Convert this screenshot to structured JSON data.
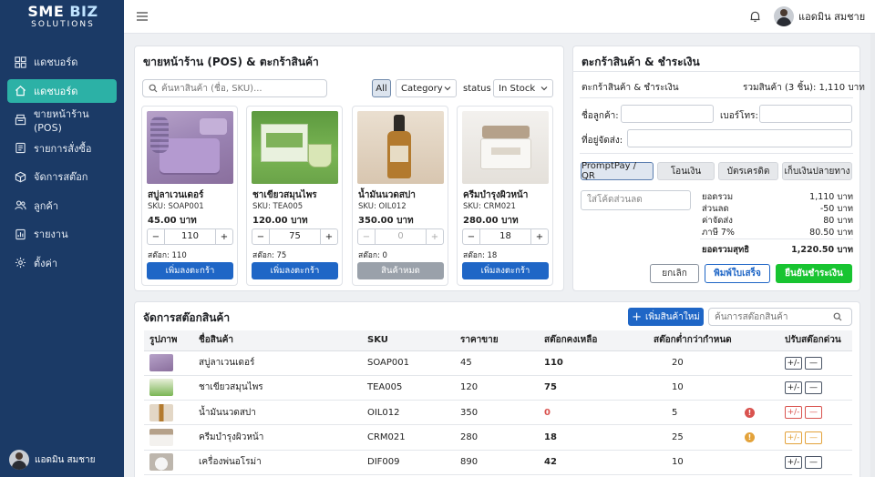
{
  "app": {
    "logo_line1": "SME",
    "logo_line1b": " BIZ",
    "logo_line2": "SOLUTIONS"
  },
  "sidebar": {
    "items": [
      {
        "label": "แดชบอร์ด",
        "icon": "grid-icon"
      },
      {
        "label": "แดชบอร์ด",
        "icon": "home-icon",
        "active": true
      },
      {
        "label": "ขายหน้าร้าน (POS)",
        "icon": "register-icon"
      },
      {
        "label": "รายการสั่งซื้อ",
        "icon": "list-icon"
      },
      {
        "label": "จัดการสต๊อก",
        "icon": "box-icon"
      },
      {
        "label": "ลูกค้า",
        "icon": "users-icon"
      },
      {
        "label": "รายงาน",
        "icon": "chart-icon"
      },
      {
        "label": "ตั้งค่า",
        "icon": "gear-icon"
      }
    ],
    "user_name": "แอดมิน สมชาย"
  },
  "topbar": {
    "user_name": "แอดมิน สมชาย"
  },
  "pos": {
    "title": "ขายหน้าร้าน (POS) & ตะกร้าสินค้า",
    "search_placeholder": "ค้นหาสินค้า (ชื่อ, SKU)...",
    "filter_all": "All",
    "category_label": "Category",
    "status_label": "status",
    "status_value": "In Stock",
    "products": [
      {
        "name": "สบู่ลาเวนเดอร์",
        "sku": "SKU: SOAP001",
        "price": "45.00 บาท",
        "qty": "110",
        "stock": "สต๊อก: 110",
        "button": "เพิ่มลงตะกร้า",
        "disabled": false
      },
      {
        "name": "ชาเขียวสมุนไพร",
        "sku": "SKU: TEA005",
        "price": "120.00 บาท",
        "qty": "75",
        "stock": "สต๊อก: 75",
        "button": "เพิ่มลงตะกร้า",
        "disabled": false
      },
      {
        "name": "น้ำมันนวดสปา",
        "sku": "SKU: OIL012",
        "price": "350.00 บาท",
        "qty": "0",
        "stock": "สต๊อก: 0",
        "button": "สินค้าหมด",
        "disabled": true
      },
      {
        "name": "ครีมบำรุงผิวหน้า",
        "sku": "SKU: CRM021",
        "price": "280.00 บาท",
        "qty": "18",
        "stock": "สต๊อก: 18",
        "button": "เพิ่มลงตะกร้า",
        "disabled": false
      }
    ]
  },
  "cart": {
    "title": "ตะกร้าสินค้า & ชำระเงิน",
    "subtitle": "ตะกร้าสินค้า & ชำระเงิน",
    "total_items": "รวมสินค้า (3 ชิ้น): 1,110 บาท",
    "customer_label": "ชื่อลูกค้า:",
    "phone_label": "เบอร์โทร:",
    "address_label": "ที่อยู่จัดส่ง:",
    "pay_methods": [
      "PromptPay / QR",
      "โอนเงิน",
      "บัตรเครดิต",
      "เก็บเงินปลายทาง"
    ],
    "discount_placeholder": "ใส่โค้ดส่วนลด",
    "summary": [
      {
        "label": "ยอดรวม",
        "value": "1,110 บาท"
      },
      {
        "label": "ส่วนลด",
        "value": "-50 บาท"
      },
      {
        "label": "ค่าจัดส่ง",
        "value": "80 บาท"
      },
      {
        "label": "ภาษี 7%",
        "value": "80.50 บาท"
      }
    ],
    "grand_label": "ยอดรวมสุทธิ",
    "grand_value": "1,220.50 บาท",
    "cancel": "ยกเลิก",
    "print": "พิมพ์ใบเสร็จ",
    "confirm": "ยืนยันชำระเงิน"
  },
  "stock": {
    "title": "จัดการสต๊อกสินค้า",
    "add_button": "เพิ่มสินค้าใหม่",
    "search_placeholder": "ค้นการสต๊อกสินค้า",
    "headers": [
      "รูปภาพ",
      "ชื่อสินค้า",
      "SKU",
      "ราคาขาย",
      "สต๊อกคงเหลือ",
      "สต๊อกต่ำกว่ากำหนด",
      "ปรับสต๊อกด่วน"
    ],
    "rows": [
      {
        "name": "สบู่ลาเวนเดอร์",
        "sku": "SOAP001",
        "price": "45",
        "stock": "110",
        "min": "20",
        "status": "ok"
      },
      {
        "name": "ชาเขียวสมุนไพร",
        "sku": "TEA005",
        "price": "120",
        "stock": "75",
        "min": "10",
        "status": "ok"
      },
      {
        "name": "น้ำมันนวดสปา",
        "sku": "OIL012",
        "price": "350",
        "stock": "0",
        "min": "5",
        "status": "out"
      },
      {
        "name": "ครีมบำรุงผิวหน้า",
        "sku": "CRM021",
        "price": "280",
        "stock": "18",
        "min": "25",
        "status": "low"
      },
      {
        "name": "เครื่องพ่นอโรม่า",
        "sku": "DIF009",
        "price": "890",
        "stock": "42",
        "min": "10",
        "status": "ok"
      }
    ],
    "adjust_plus": "+/-",
    "adjust_minus": "—"
  },
  "colors": {
    "sidebar": "#1b3a66",
    "active": "#2cb1a6",
    "primary": "#1f66c6",
    "confirm": "#18c431",
    "danger": "#d9534f",
    "warning": "#e3a23a"
  }
}
